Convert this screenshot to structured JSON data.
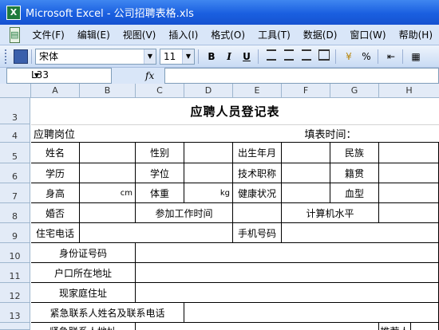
{
  "window": {
    "title": "Microsoft Excel - 公司招聘表格.xls"
  },
  "menu": [
    "文件(F)",
    "编辑(E)",
    "视图(V)",
    "插入(I)",
    "格式(O)",
    "工具(T)",
    "数据(D)",
    "窗口(W)",
    "帮助(H)"
  ],
  "toolbar": {
    "font_name": "宋体",
    "font_size": "11",
    "bold": "B",
    "italic": "I",
    "underline": "U",
    "percent": "%"
  },
  "formula": {
    "name_box": "L33",
    "fx": "fx",
    "content": ""
  },
  "columns": [
    "A",
    "B",
    "C",
    "D",
    "E",
    "F",
    "G",
    "H"
  ],
  "rows": [
    "3",
    "4",
    "5",
    "6",
    "7",
    "8",
    "9",
    "10",
    "11",
    "12",
    "13"
  ],
  "sheet": {
    "title": "应聘人员登记表",
    "position_label": "应聘岗位",
    "fill_time_label": "填表时间：",
    "name": "姓名",
    "gender": "性别",
    "birth": "出生年月",
    "ethnicity": "民族",
    "education": "学历",
    "degree": "学位",
    "tech_title": "技术职称",
    "native_place": "籍贯",
    "height": "身高",
    "cm": "cm",
    "weight": "体重",
    "kg": "kg",
    "health": "健康状况",
    "blood": "血型",
    "marital": "婚否",
    "work_start": "参加工作时间",
    "computer_level": "计算机水平",
    "home_phone": "住宅电话",
    "mobile": "手机号码",
    "id_number": "身份证号码",
    "hukou": "户口所在地址",
    "current_address": "现家庭住址",
    "emergency": "紧急联系人姓名及联系电话",
    "bottom_partial_left": "紧急联系人地址",
    "bottom_partial_right": "推荐人"
  }
}
